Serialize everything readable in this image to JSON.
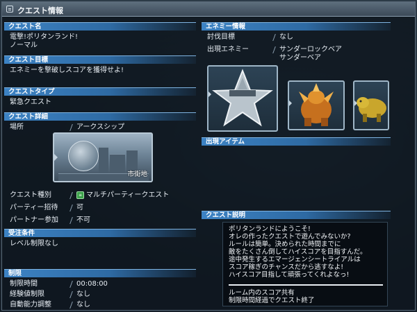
{
  "window": {
    "title": "クエスト情報"
  },
  "left": {
    "quest_name": {
      "header": "クエスト名",
      "line1": "電撃!ポリタンランド!",
      "line2": "ノーマル"
    },
    "quest_goal": {
      "header": "クエスト目標",
      "text": "エネミーを撃破しスコアを獲得せよ!"
    },
    "quest_type": {
      "header": "クエストタイプ",
      "text": "緊急クエスト"
    },
    "quest_detail": {
      "header": "クエスト詳細",
      "location_label": "場所",
      "location_value": "アークスシップ",
      "area_thumb_label": "市街地",
      "rows": [
        {
          "label": "クエスト種別",
          "value": "マルチパーティークエスト"
        },
        {
          "label": "パーティー招待",
          "value": "可"
        },
        {
          "label": "パートナー参加",
          "value": "不可"
        }
      ]
    },
    "conditions": {
      "header": "受注条件",
      "text": "レベル制限なし"
    },
    "limits": {
      "header": "制限",
      "rows": [
        {
          "label": "制限時間",
          "value": "00:08:00"
        },
        {
          "label": "経験値制限",
          "value": "なし"
        },
        {
          "label": "自動能力調整",
          "value": "なし"
        }
      ]
    }
  },
  "right": {
    "enemy_info": {
      "header": "エネミー情報",
      "target_label": "討伐目標",
      "target_value": "なし",
      "appear_label": "出現エネミー",
      "enemies": [
        "サンダーロックベア",
        "サンダーベア"
      ],
      "card_icons": [
        "star-emblem-icon",
        "rock-bear-icon",
        "bear-icon"
      ]
    },
    "items": {
      "header": "出現アイテム"
    },
    "description": {
      "header": "クエスト説明",
      "lines": [
        "ポリタンランドにようこそ!",
        "オレの作ったクエストで遊んでみないか?",
        "ルールは簡単。決められた時間までに",
        "敵をたくさん倒してハイスコアを目指すんだ。",
        "途中発生するエマージェンシートライアルは",
        "スコア稼ぎのチャンスだから逃すなよ!",
        "ハイスコア目指して頑張ってくれよなっ!"
      ],
      "footer_lines": [
        "ルーム内のスコア共有",
        "制限時間経過でクエスト終了"
      ]
    }
  },
  "colors": {
    "header_blue": "#3d83c4",
    "panel_bg": "#0e161e"
  }
}
